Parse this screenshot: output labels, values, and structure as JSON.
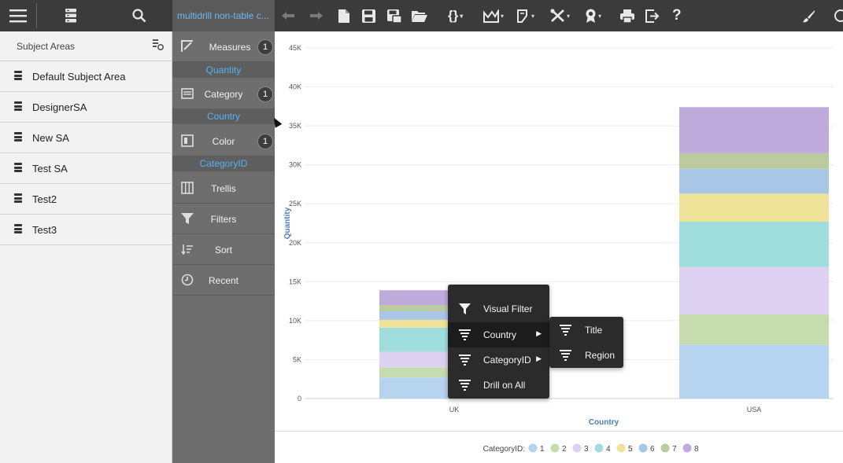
{
  "toolbar": {
    "menu_icon": "hamburger-icon",
    "data_icon": "database-icon",
    "search_icon": "search-icon",
    "document_title": "multidrill non-table c...",
    "tools": [
      "undo-icon",
      "redo-icon",
      "new-document-icon",
      "save-icon",
      "save-as-icon",
      "open-folder-icon",
      "expression-icon",
      "chart-type-icon",
      "format-icon",
      "tools-icon",
      "badge-icon",
      "print-icon",
      "export-icon",
      "help-icon",
      "brush-icon"
    ],
    "help_label": "?"
  },
  "sidebar": {
    "header": "Subject Areas",
    "items": [
      {
        "label": "Default Subject Area"
      },
      {
        "label": "DesignerSA"
      },
      {
        "label": "New SA"
      },
      {
        "label": "Test SA"
      },
      {
        "label": "Test2"
      },
      {
        "label": "Test3"
      }
    ]
  },
  "fields": {
    "measures": {
      "label": "Measures",
      "count": "1",
      "value": "Quantity"
    },
    "category": {
      "label": "Category",
      "count": "1",
      "value": "Country"
    },
    "color": {
      "label": "Color",
      "count": "1",
      "value": "CategoryID"
    },
    "trellis": {
      "label": "Trellis"
    },
    "filters": {
      "label": "Filters"
    },
    "sort": {
      "label": "Sort"
    },
    "recent": {
      "label": "Recent"
    }
  },
  "context_menu": {
    "items": [
      {
        "label": "Visual Filter",
        "icon": "funnel-icon"
      },
      {
        "label": "Country",
        "icon": "drill-icon",
        "has_submenu": true
      },
      {
        "label": "CategoryID",
        "icon": "drill-icon",
        "has_submenu": true
      },
      {
        "label": "Drill on All",
        "icon": "drill-icon"
      }
    ],
    "submenu": [
      {
        "label": "Title"
      },
      {
        "label": "Region"
      }
    ]
  },
  "chart_data": {
    "type": "bar",
    "stacked": true,
    "xlabel": "Country",
    "ylabel": "Quantity",
    "categories": [
      "UK",
      "USA"
    ],
    "ylim": [
      0,
      45000
    ],
    "yticks": [
      "0",
      "5K",
      "10K",
      "15K",
      "20K",
      "25K",
      "30K",
      "35K",
      "40K",
      "45K"
    ],
    "grid": true,
    "legend_title": "CategoryID:",
    "legend_position": "bottom",
    "series": [
      {
        "name": "1",
        "color": "#b6d4f0",
        "values": [
          2700,
          6900
        ]
      },
      {
        "name": "2",
        "color": "#c6dcae",
        "values": [
          1300,
          3900
        ]
      },
      {
        "name": "3",
        "color": "#dcd1f0",
        "values": [
          2000,
          6100
        ]
      },
      {
        "name": "4",
        "color": "#a0dede",
        "values": [
          3100,
          5800
        ]
      },
      {
        "name": "5",
        "color": "#efe39a",
        "values": [
          1000,
          3600
        ]
      },
      {
        "name": "6",
        "color": "#a9c6e6",
        "values": [
          1100,
          3200
        ]
      },
      {
        "name": "7",
        "color": "#bccb9f",
        "values": [
          800,
          2000
        ]
      },
      {
        "name": "8",
        "color": "#bfaadc",
        "values": [
          1900,
          5900
        ]
      }
    ]
  }
}
